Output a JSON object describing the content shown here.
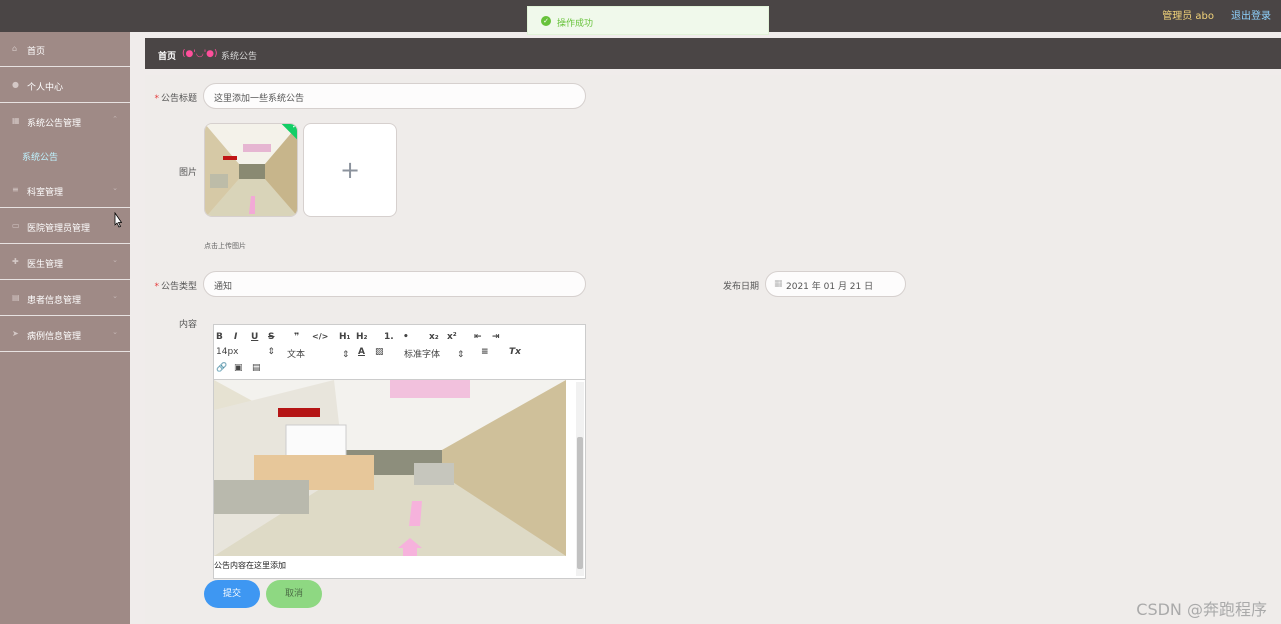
{
  "topbar": {
    "user_label": "管理员 abo",
    "logout_label": "退出登录"
  },
  "toast": {
    "message": "操作成功"
  },
  "sidebar": {
    "items": [
      {
        "label": "首页",
        "icon": "home-icon",
        "expandable": false
      },
      {
        "label": "个人中心",
        "icon": "user-icon",
        "expandable": false
      },
      {
        "label": "系统公告管理",
        "icon": "grid-icon",
        "expandable": true
      },
      {
        "label": "科室管理",
        "icon": "list-icon",
        "expandable": true
      },
      {
        "label": "医院管理员管理",
        "icon": "card-icon",
        "expandable": true
      },
      {
        "label": "医生管理",
        "icon": "doctor-icon",
        "expandable": true
      },
      {
        "label": "患者信息管理",
        "icon": "patient-icon",
        "expandable": true
      },
      {
        "label": "病例信息管理",
        "icon": "send-icon",
        "expandable": true
      }
    ],
    "active_sub": "系统公告"
  },
  "breadcrumb": {
    "home": "首页",
    "face": "(●'◡'●)",
    "current": "系统公告"
  },
  "form": {
    "title_label": "公告标题",
    "title_value": "这里添加一些系统公告",
    "image_label": "图片",
    "upload_tip": "点击上传图片",
    "type_label": "公告类型",
    "type_value": "通知",
    "date_label": "发布日期",
    "date_value": "2021 年 01 月 21 日",
    "content_label": "内容",
    "content_text": "公告内容在这里添加",
    "submit_label": "提交",
    "cancel_label": "取消"
  },
  "editor": {
    "font_size": "14px",
    "text_style": "文本",
    "font_family": "标准字体",
    "tools": [
      "B",
      "I",
      "U",
      "S",
      "❞",
      "</>",
      "H₁",
      "H₂",
      "1.",
      "•",
      "x₂",
      "x²",
      "⇤",
      "⇥",
      "A",
      "▨",
      "≡",
      "Tx",
      "link",
      "image",
      "video"
    ]
  },
  "watermark": "CSDN @奔跑程序",
  "colors": {
    "topbar": "#4a4545",
    "sidebar": "#9f8a86",
    "primary": "#3e97f2",
    "cancel": "#8ed882"
  }
}
